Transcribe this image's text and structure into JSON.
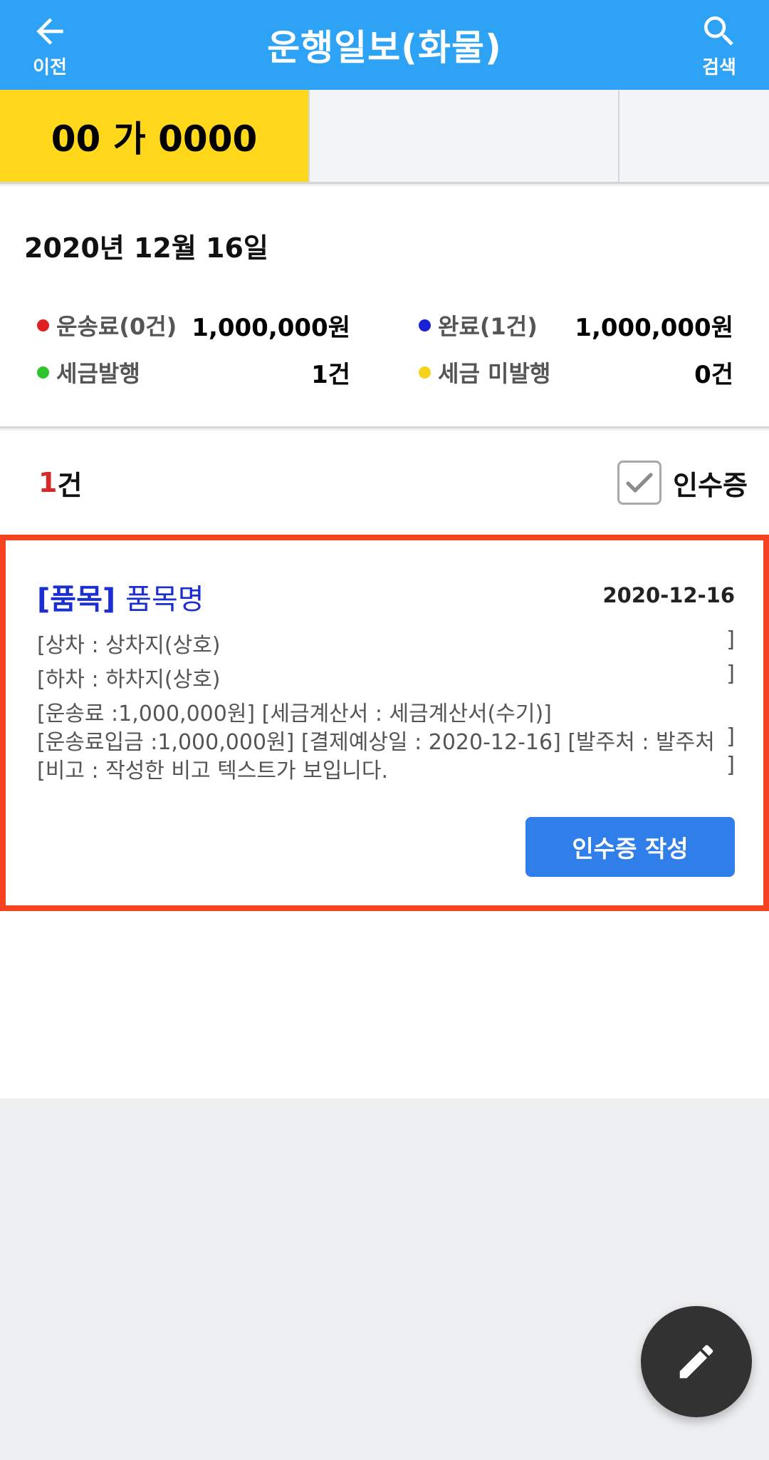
{
  "header": {
    "title": "운행일보(화물)",
    "back_label": "이전",
    "search_label": "검색",
    "back_icon": "arrow-left-icon",
    "search_icon": "search-icon",
    "bg_color": "#2ea3f6"
  },
  "tabs": [
    {
      "label": "00 가 0000",
      "active": true
    },
    {
      "label": "",
      "active": false
    },
    {
      "label": "",
      "active": false
    }
  ],
  "summary": {
    "date": "2020년 12월 16일",
    "stats": [
      {
        "label": "운송료(0건)",
        "value": "1,000,000원",
        "color": "#e02020"
      },
      {
        "label": "완료(1건)",
        "value": "1,000,000원",
        "color": "#1a22d6"
      },
      {
        "label": "세금발행",
        "value": "1건",
        "color": "#2ec52e"
      },
      {
        "label": "세금 미발행",
        "value": "0건",
        "color": "#f5d21c"
      }
    ]
  },
  "list": {
    "count_num": "1",
    "count_unit": "건",
    "receipt_filter_label": "인수증",
    "receipt_filter_checked": true
  },
  "record": {
    "item_tag": "[품목]",
    "item_name": "품목명",
    "date": "2020-12-16",
    "loading": "[상차 : 상차지(상호)",
    "unloading": "[하차 : 하차지(상호)",
    "fare_line": "[운송료 :1,000,000원] [세금계산서 : 세금계산서(수기)]",
    "deposit_line": "[운송료입금 :1,000,000원] [결제예상일 : 2020-12-16] [발주처 : 발주처",
    "note_line": "[비고 : 작성한 비고 텍스트가 보입니다.",
    "bracket_close": "]",
    "write_button": "인수증 작성"
  },
  "fab": {
    "icon": "pencil-icon"
  }
}
